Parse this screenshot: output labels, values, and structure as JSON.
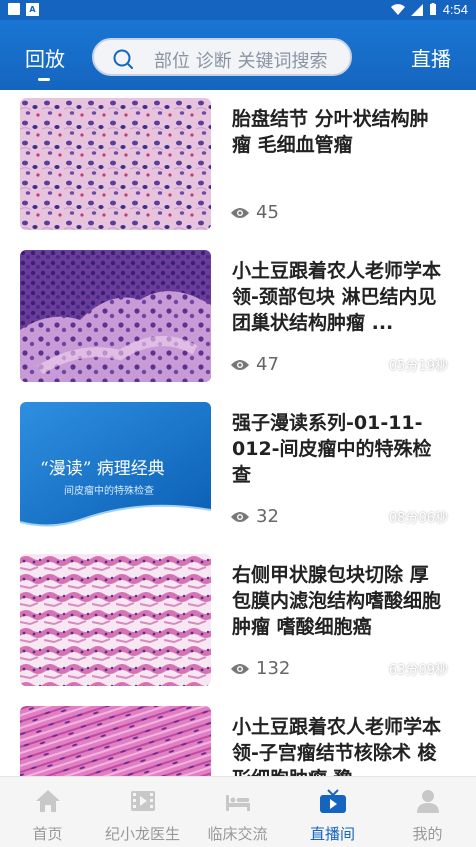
{
  "status_bar": {
    "time": "4:54"
  },
  "header": {
    "left_tab": "回放",
    "right_tab": "直播",
    "search_placeholder": "部位 诊断 关键词搜索"
  },
  "videos": [
    {
      "title": "胎盘结节 分叶状结构肿瘤 毛细血管瘤",
      "views": "45",
      "duration": ""
    },
    {
      "title": "小土豆跟着农人老师学本领-颈部包块 淋巴结内见团巢状结构肿瘤 ...",
      "views": "47",
      "duration": "05分19秒"
    },
    {
      "title": "强子漫读系列-01-11-012-间皮瘤中的特殊检查",
      "views": "32",
      "duration": "08分06秒",
      "thumb_text": "“漫读” 病理经典",
      "thumb_subtext": "间皮瘤中的特殊检查"
    },
    {
      "title": "右侧甲状腺包块切除 厚包膜内滤泡结构嗜酸细胞肿瘤 嗜酸细胞癌",
      "views": "132",
      "duration": "63分09秒"
    },
    {
      "title": "小土豆跟着农人老师学本领-子宫瘤结节核除术 梭形细胞肿瘤 豫",
      "views": "",
      "duration": ""
    }
  ],
  "bottom_nav": [
    {
      "label": "首页",
      "icon": "home-icon"
    },
    {
      "label": "纪小龙医生",
      "icon": "film-icon"
    },
    {
      "label": "临床交流",
      "icon": "bed-icon"
    },
    {
      "label": "直播间",
      "icon": "tv-icon",
      "active": true
    },
    {
      "label": "我的",
      "icon": "person-icon"
    }
  ],
  "colors": {
    "primary": "#1565c0",
    "inactive": "#999999"
  }
}
